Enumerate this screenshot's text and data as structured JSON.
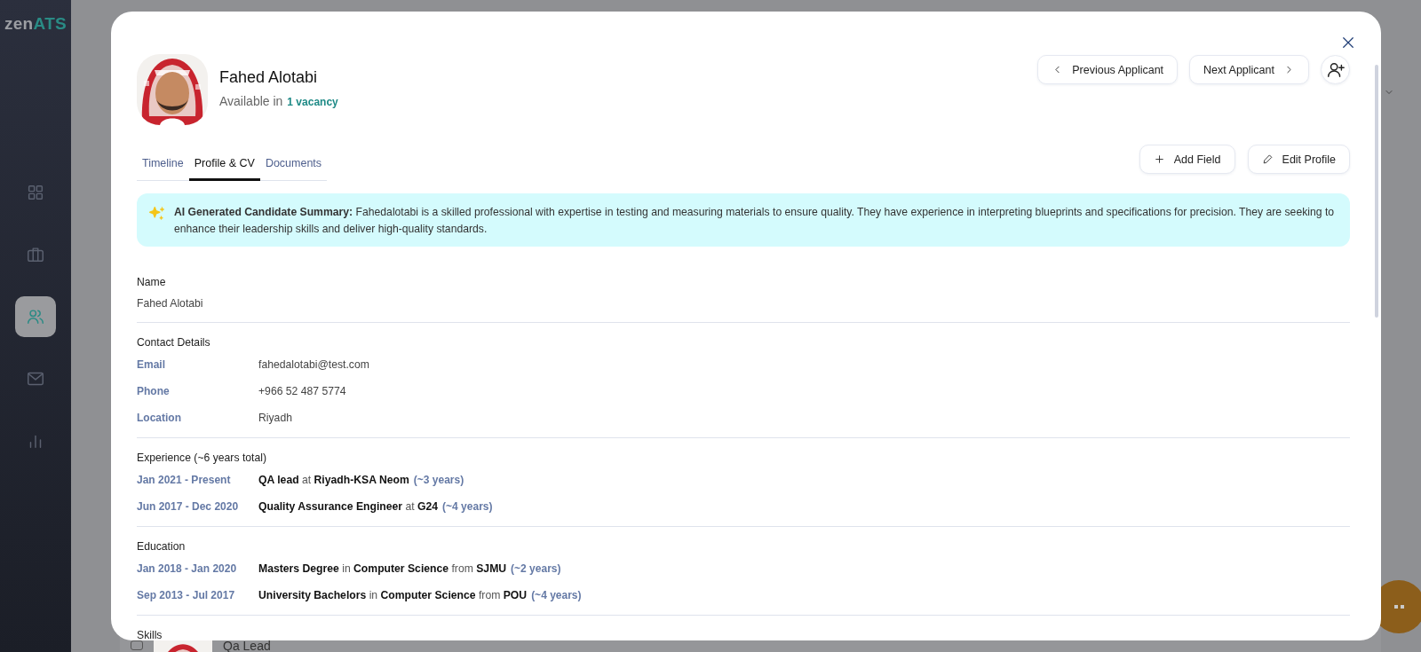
{
  "sidebar": {
    "logo": {
      "main": "zen",
      "accent": "ATS"
    },
    "nav": [
      {
        "kind": "grid",
        "selected": false
      },
      {
        "kind": "briefcase",
        "selected": false
      },
      {
        "kind": "people",
        "selected": true
      },
      {
        "kind": "mail",
        "selected": false
      },
      {
        "kind": "chart",
        "selected": false
      }
    ]
  },
  "background": {
    "checked": false,
    "row_title": "Qa Lead"
  },
  "modal": {
    "candidate": {
      "name": "Fahed Alotabi",
      "availability": "Available in",
      "vacancy_link": "1 vacancy"
    },
    "header_buttons": [
      {
        "kind": "prev",
        "label": "Previous Applicant"
      },
      {
        "kind": "next",
        "label": "Next Applicant"
      },
      {
        "kind": "add-user"
      }
    ],
    "tabs": [
      {
        "label": "Timeline",
        "selected": false
      },
      {
        "label": "Profile & CV",
        "selected": true
      },
      {
        "label": "Documents",
        "selected": false
      }
    ],
    "actions": [
      {
        "kind": "add",
        "label": "Add Field"
      },
      {
        "kind": "edit",
        "label": "Edit Profile"
      }
    ],
    "summary": "**AI Generated Candidate Summary:** Fahedalotabi is a skilled professional with expertise in testing and measuring materials to ensure quality. They have experience in interpreting blueprints and specifications for precision. They are seeking to enhance their leadership skills and deliver high-quality standards.",
    "sections": [
      {
        "kind": "value",
        "title": "Name",
        "value": "Fahed Alotabi"
      },
      {
        "kind": "pairs",
        "title": "Contact Details",
        "rows": [
          {
            "label": "Email",
            "value": "fahedalotabi@test.com"
          },
          {
            "label": "Phone",
            "value": "+966 52 487 5774"
          },
          {
            "label": "Location",
            "value": "Riyadh"
          }
        ]
      },
      {
        "kind": "entries",
        "title": "Experience (~6 years total)",
        "rows": [
          {
            "dates": "Jan 2021 - Present",
            "description": "**QA lead** at **Riyadh-KSA Neom**",
            "duration": "(~3 years)"
          },
          {
            "dates": "Jun 2017 - Dec 2020",
            "description": "**Quality Assurance Engineer** at **G24**",
            "duration": "(~4 years)"
          }
        ]
      },
      {
        "kind": "entries",
        "title": "Education",
        "rows": [
          {
            "dates": "Jan 2018 - Jan 2020",
            "description": "**Masters Degree** in **Computer Science** from **SJMU**",
            "duration": "(~2 years)"
          },
          {
            "dates": "Sep 2013 - Jul 2017",
            "description": "**University Bachelors** in **Computer Science** from **POU**",
            "duration": "(~4 years)"
          }
        ]
      },
      {
        "kind": "title",
        "title": "Skills"
      }
    ]
  }
}
